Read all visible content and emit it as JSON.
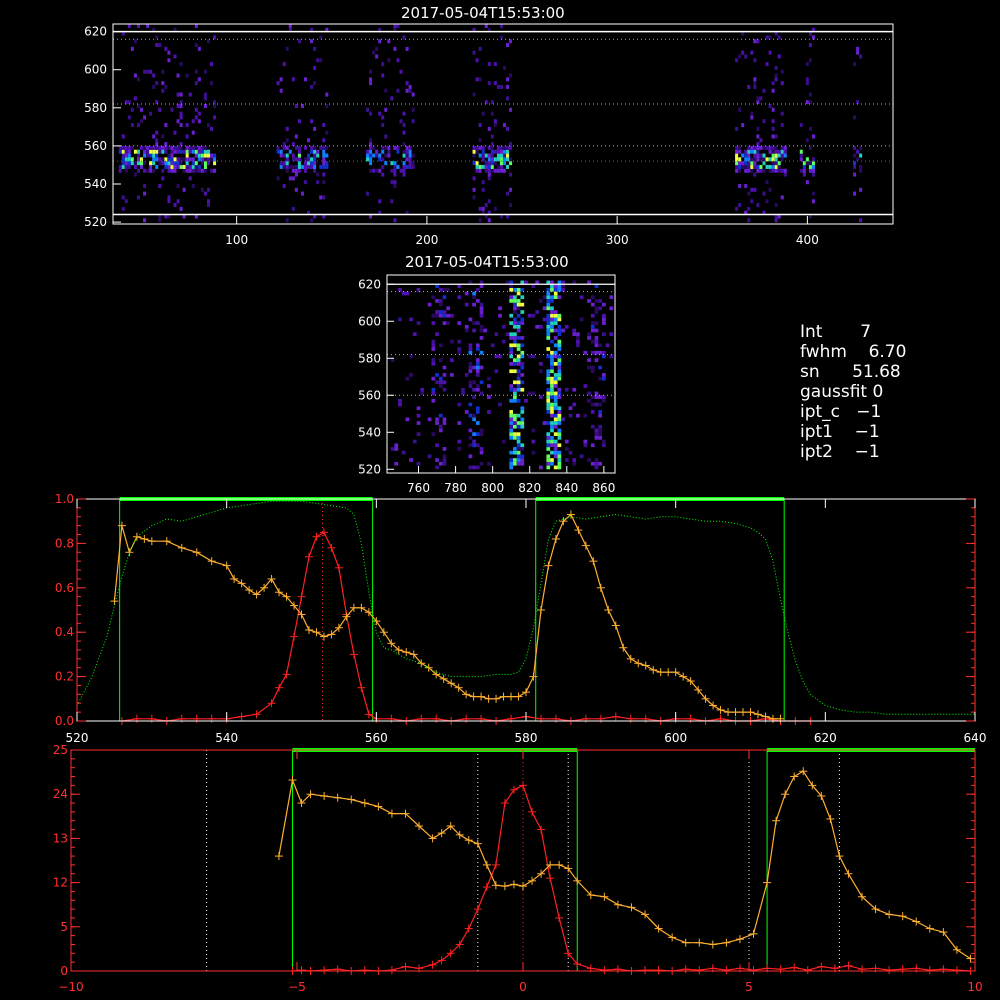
{
  "panels": {
    "top": {
      "title": "2017-05-04T15:53:00",
      "x_ticks": [
        "100",
        "200",
        "300",
        "400"
      ],
      "y_ticks": [
        "520",
        "540",
        "560",
        "580",
        "600",
        "620"
      ]
    },
    "middle": {
      "title": "2017-05-04T15:53:00",
      "x_ticks": [
        "760",
        "780",
        "800",
        "820",
        "840",
        "860"
      ],
      "y_ticks": [
        "520",
        "540",
        "560",
        "580",
        "600",
        "620"
      ]
    }
  },
  "info": {
    "int_label": "Int",
    "int_value": "7",
    "fwhm_label": "fwhm",
    "fwhm_value": "6.70",
    "sn_label": "sn",
    "sn_value": "51.68",
    "gaussfit_label": "gaussfit",
    "gaussfit_value": "0",
    "ipt_c_label": "ipt_c",
    "ipt_c_value": "−1",
    "ipt1_label": "ipt1",
    "ipt1_value": "−1",
    "ipt2_label": "ipt2",
    "ipt2_value": "−1"
  },
  "colors": {
    "red": "#ff2020",
    "orange": "#ffb030",
    "green": "#00ff00",
    "grid_green": "#3cff3c",
    "axis_white": "#ffffff",
    "axis_red": "#ff3030"
  },
  "chart_data": [
    {
      "type": "line",
      "xlim": [
        520,
        640
      ],
      "ylim": [
        0,
        1.0
      ],
      "x_ticks": [
        "520",
        "540",
        "560",
        "580",
        "600",
        "620",
        "640"
      ],
      "y_ticks": [
        "0.0",
        "0.2",
        "0.4",
        "0.6",
        "0.8",
        "1.0"
      ],
      "green_boxes": [
        [
          525.7,
          559.5
        ],
        [
          581.3,
          614.5
        ]
      ],
      "vline": 552.8,
      "series": [
        {
          "color": "red",
          "x": [
            526,
            528,
            530,
            532,
            534,
            536,
            538,
            540,
            542,
            544,
            546,
            547,
            548,
            549,
            550,
            551,
            552,
            553,
            554,
            555,
            556,
            557,
            558,
            559,
            560,
            562,
            564,
            566,
            568,
            570,
            572,
            574,
            576,
            578,
            580,
            582,
            584,
            586,
            588,
            590,
            592,
            594,
            596,
            598,
            600,
            602,
            604,
            606,
            608,
            610,
            612,
            614,
            616,
            618
          ],
          "y": [
            0.0,
            0.01,
            0.01,
            0.0,
            0.01,
            0.01,
            0.01,
            0.01,
            0.02,
            0.03,
            0.08,
            0.15,
            0.21,
            0.38,
            0.56,
            0.74,
            0.83,
            0.85,
            0.78,
            0.69,
            0.48,
            0.3,
            0.15,
            0.03,
            0.01,
            0.01,
            0.0,
            0.01,
            0.01,
            0.0,
            0.01,
            0.01,
            0.0,
            0.01,
            0.02,
            0.01,
            0.01,
            0.0,
            0.01,
            0.01,
            0.02,
            0.01,
            0.01,
            0.0,
            0.01,
            0.01,
            0.0,
            0.01,
            0.0,
            0.0,
            0.01,
            0.0,
            0.0,
            0.0
          ]
        },
        {
          "color": "orange",
          "x": [
            525,
            526,
            527,
            528,
            529,
            530,
            532,
            534,
            536,
            538,
            540,
            541,
            542,
            543,
            544,
            545,
            546,
            547,
            548,
            549,
            550,
            551,
            552,
            553,
            554,
            555,
            556,
            557,
            558,
            559,
            560,
            561,
            562,
            563,
            564,
            565,
            566,
            567,
            568,
            569,
            570,
            571,
            572,
            573,
            574,
            575,
            576,
            577,
            578,
            579,
            580,
            581,
            582,
            583,
            584,
            585,
            586,
            587,
            588,
            589,
            590,
            591,
            592,
            593,
            594,
            595,
            596,
            597,
            598,
            599,
            600,
            601,
            602,
            603,
            604,
            605,
            606,
            607,
            608,
            609,
            610,
            611,
            612,
            613,
            614
          ],
          "y": [
            0.54,
            0.88,
            0.76,
            0.83,
            0.82,
            0.81,
            0.81,
            0.78,
            0.76,
            0.72,
            0.7,
            0.64,
            0.62,
            0.59,
            0.57,
            0.6,
            0.64,
            0.58,
            0.56,
            0.52,
            0.48,
            0.41,
            0.4,
            0.38,
            0.39,
            0.42,
            0.47,
            0.51,
            0.51,
            0.49,
            0.45,
            0.4,
            0.35,
            0.32,
            0.31,
            0.3,
            0.26,
            0.24,
            0.21,
            0.19,
            0.17,
            0.15,
            0.12,
            0.11,
            0.11,
            0.1,
            0.1,
            0.11,
            0.11,
            0.11,
            0.13,
            0.2,
            0.5,
            0.7,
            0.82,
            0.9,
            0.93,
            0.86,
            0.79,
            0.72,
            0.6,
            0.5,
            0.43,
            0.33,
            0.28,
            0.26,
            0.25,
            0.23,
            0.22,
            0.22,
            0.22,
            0.2,
            0.18,
            0.14,
            0.1,
            0.07,
            0.05,
            0.04,
            0.04,
            0.04,
            0.04,
            0.03,
            0.02,
            0.01,
            0.01
          ]
        },
        {
          "color": "green",
          "dotted": true,
          "x": [
            520,
            522,
            524,
            525,
            526,
            527,
            528,
            530,
            532,
            534,
            536,
            538,
            540,
            542,
            544,
            546,
            548,
            550,
            552,
            554,
            556,
            557,
            558,
            559,
            560,
            561,
            562,
            563,
            564,
            566,
            568,
            570,
            572,
            574,
            576,
            577,
            578,
            579,
            580,
            581,
            582,
            583,
            584,
            586,
            588,
            590,
            592,
            594,
            596,
            598,
            600,
            602,
            604,
            606,
            608,
            610,
            611,
            612,
            613,
            614,
            615,
            616,
            617,
            618,
            620,
            622,
            624,
            626,
            628,
            630,
            632,
            634,
            636,
            638,
            640
          ],
          "y": [
            0.07,
            0.2,
            0.38,
            0.52,
            0.65,
            0.76,
            0.83,
            0.88,
            0.91,
            0.9,
            0.92,
            0.94,
            0.96,
            0.97,
            0.98,
            0.99,
            0.99,
            0.99,
            0.98,
            0.97,
            0.96,
            0.93,
            0.8,
            0.58,
            0.4,
            0.33,
            0.32,
            0.3,
            0.28,
            0.26,
            0.22,
            0.2,
            0.2,
            0.2,
            0.21,
            0.21,
            0.21,
            0.22,
            0.28,
            0.42,
            0.62,
            0.82,
            0.9,
            0.92,
            0.91,
            0.92,
            0.93,
            0.92,
            0.91,
            0.92,
            0.92,
            0.91,
            0.9,
            0.9,
            0.89,
            0.87,
            0.85,
            0.82,
            0.72,
            0.55,
            0.4,
            0.27,
            0.18,
            0.12,
            0.07,
            0.05,
            0.04,
            0.04,
            0.03,
            0.03,
            0.03,
            0.03,
            0.03,
            0.03,
            0.03
          ]
        }
      ]
    },
    {
      "type": "line",
      "xlim": [
        -10,
        10
      ],
      "ylim": [
        0,
        25
      ],
      "x_ticks": [
        "−10",
        "−5",
        "0",
        "5",
        "10"
      ],
      "y_ticks": [
        "0",
        "5",
        "12",
        "13",
        "24",
        "25"
      ],
      "green_boxes": [
        [
          -5.1,
          1.2
        ],
        [
          5.4,
          10
        ]
      ],
      "vlines_white": [
        -7,
        -1,
        1,
        5,
        7
      ],
      "vline": 0,
      "series": [
        {
          "color": "red",
          "x": [
            -5.1,
            -4.9,
            -4.7,
            -4.4,
            -4.1,
            -3.8,
            -3.5,
            -3.2,
            -2.9,
            -2.6,
            -2.3,
            -2.0,
            -1.8,
            -1.6,
            -1.4,
            -1.2,
            -1.0,
            -0.8,
            -0.6,
            -0.4,
            -0.2,
            0.0,
            0.2,
            0.4,
            0.6,
            0.8,
            1.0,
            1.2,
            1.5,
            1.8,
            2.1,
            2.4,
            2.7,
            3.0,
            3.3,
            3.6,
            3.9,
            4.2,
            4.5,
            4.8,
            5.1,
            5.4,
            5.7,
            6.0,
            6.3,
            6.6,
            6.9,
            7.2,
            7.5,
            7.8,
            8.1,
            8.4,
            8.7,
            9.0,
            9.3,
            9.6,
            9.9
          ],
          "y": [
            0.0,
            0.1,
            0.0,
            0.1,
            0.2,
            0.0,
            0.1,
            0.0,
            0.1,
            0.5,
            0.3,
            0.7,
            1.2,
            2.0,
            3.0,
            4.8,
            7.0,
            9.5,
            12.0,
            19.0,
            20.5,
            21.0,
            18.0,
            16.0,
            10.5,
            6.0,
            2.0,
            0.8,
            0.3,
            0.1,
            0.2,
            0.0,
            0.1,
            0.1,
            0.0,
            0.2,
            0.1,
            0.3,
            0.1,
            0.3,
            0.1,
            0.3,
            0.2,
            0.4,
            0.1,
            0.5,
            0.3,
            0.6,
            0.2,
            0.3,
            0.1,
            0.2,
            0.3,
            0.1,
            0.2,
            0.1,
            0.0
          ]
        },
        {
          "color": "orange",
          "x": [
            -5.4,
            -5.1,
            -4.9,
            -4.7,
            -4.4,
            -4.1,
            -3.8,
            -3.5,
            -3.2,
            -2.9,
            -2.6,
            -2.3,
            -2.0,
            -1.8,
            -1.6,
            -1.4,
            -1.2,
            -1.0,
            -0.8,
            -0.6,
            -0.4,
            -0.2,
            0.0,
            0.2,
            0.4,
            0.6,
            0.8,
            1.0,
            1.2,
            1.5,
            1.8,
            2.1,
            2.4,
            2.7,
            3.0,
            3.3,
            3.6,
            3.9,
            4.2,
            4.5,
            4.8,
            5.1,
            5.4,
            5.6,
            5.8,
            6.0,
            6.2,
            6.4,
            6.6,
            6.8,
            7.0,
            7.2,
            7.5,
            7.8,
            8.1,
            8.4,
            8.7,
            9.0,
            9.3,
            9.6,
            9.9
          ],
          "y": [
            13.0,
            21.6,
            19.0,
            20.0,
            19.8,
            19.6,
            19.4,
            19.0,
            18.6,
            17.8,
            17.8,
            16.4,
            15.0,
            15.6,
            16.4,
            15.4,
            14.8,
            14.4,
            12.0,
            9.7,
            9.6,
            9.8,
            9.6,
            10.2,
            11.0,
            12.0,
            12.0,
            11.6,
            10.2,
            8.6,
            8.4,
            7.5,
            7.2,
            6.4,
            4.8,
            3.8,
            3.2,
            3.2,
            3.0,
            3.2,
            3.6,
            4.2,
            10.0,
            17.0,
            20.0,
            22.0,
            22.6,
            21.0,
            19.8,
            17.2,
            13.0,
            11.0,
            8.4,
            7.0,
            6.4,
            6.2,
            5.6,
            4.8,
            4.4,
            2.4,
            1.4
          ]
        }
      ]
    }
  ]
}
